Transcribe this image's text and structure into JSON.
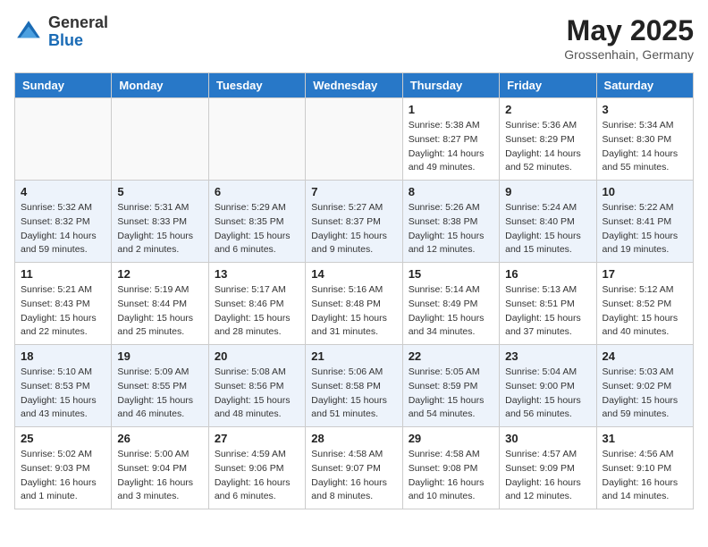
{
  "header": {
    "logo_general": "General",
    "logo_blue": "Blue",
    "month_year": "May 2025",
    "location": "Grossenhain, Germany"
  },
  "weekdays": [
    "Sunday",
    "Monday",
    "Tuesday",
    "Wednesday",
    "Thursday",
    "Friday",
    "Saturday"
  ],
  "weeks": [
    [
      {
        "day": "",
        "info": ""
      },
      {
        "day": "",
        "info": ""
      },
      {
        "day": "",
        "info": ""
      },
      {
        "day": "",
        "info": ""
      },
      {
        "day": "1",
        "info": "Sunrise: 5:38 AM\nSunset: 8:27 PM\nDaylight: 14 hours\nand 49 minutes."
      },
      {
        "day": "2",
        "info": "Sunrise: 5:36 AM\nSunset: 8:29 PM\nDaylight: 14 hours\nand 52 minutes."
      },
      {
        "day": "3",
        "info": "Sunrise: 5:34 AM\nSunset: 8:30 PM\nDaylight: 14 hours\nand 55 minutes."
      }
    ],
    [
      {
        "day": "4",
        "info": "Sunrise: 5:32 AM\nSunset: 8:32 PM\nDaylight: 14 hours\nand 59 minutes."
      },
      {
        "day": "5",
        "info": "Sunrise: 5:31 AM\nSunset: 8:33 PM\nDaylight: 15 hours\nand 2 minutes."
      },
      {
        "day": "6",
        "info": "Sunrise: 5:29 AM\nSunset: 8:35 PM\nDaylight: 15 hours\nand 6 minutes."
      },
      {
        "day": "7",
        "info": "Sunrise: 5:27 AM\nSunset: 8:37 PM\nDaylight: 15 hours\nand 9 minutes."
      },
      {
        "day": "8",
        "info": "Sunrise: 5:26 AM\nSunset: 8:38 PM\nDaylight: 15 hours\nand 12 minutes."
      },
      {
        "day": "9",
        "info": "Sunrise: 5:24 AM\nSunset: 8:40 PM\nDaylight: 15 hours\nand 15 minutes."
      },
      {
        "day": "10",
        "info": "Sunrise: 5:22 AM\nSunset: 8:41 PM\nDaylight: 15 hours\nand 19 minutes."
      }
    ],
    [
      {
        "day": "11",
        "info": "Sunrise: 5:21 AM\nSunset: 8:43 PM\nDaylight: 15 hours\nand 22 minutes."
      },
      {
        "day": "12",
        "info": "Sunrise: 5:19 AM\nSunset: 8:44 PM\nDaylight: 15 hours\nand 25 minutes."
      },
      {
        "day": "13",
        "info": "Sunrise: 5:17 AM\nSunset: 8:46 PM\nDaylight: 15 hours\nand 28 minutes."
      },
      {
        "day": "14",
        "info": "Sunrise: 5:16 AM\nSunset: 8:48 PM\nDaylight: 15 hours\nand 31 minutes."
      },
      {
        "day": "15",
        "info": "Sunrise: 5:14 AM\nSunset: 8:49 PM\nDaylight: 15 hours\nand 34 minutes."
      },
      {
        "day": "16",
        "info": "Sunrise: 5:13 AM\nSunset: 8:51 PM\nDaylight: 15 hours\nand 37 minutes."
      },
      {
        "day": "17",
        "info": "Sunrise: 5:12 AM\nSunset: 8:52 PM\nDaylight: 15 hours\nand 40 minutes."
      }
    ],
    [
      {
        "day": "18",
        "info": "Sunrise: 5:10 AM\nSunset: 8:53 PM\nDaylight: 15 hours\nand 43 minutes."
      },
      {
        "day": "19",
        "info": "Sunrise: 5:09 AM\nSunset: 8:55 PM\nDaylight: 15 hours\nand 46 minutes."
      },
      {
        "day": "20",
        "info": "Sunrise: 5:08 AM\nSunset: 8:56 PM\nDaylight: 15 hours\nand 48 minutes."
      },
      {
        "day": "21",
        "info": "Sunrise: 5:06 AM\nSunset: 8:58 PM\nDaylight: 15 hours\nand 51 minutes."
      },
      {
        "day": "22",
        "info": "Sunrise: 5:05 AM\nSunset: 8:59 PM\nDaylight: 15 hours\nand 54 minutes."
      },
      {
        "day": "23",
        "info": "Sunrise: 5:04 AM\nSunset: 9:00 PM\nDaylight: 15 hours\nand 56 minutes."
      },
      {
        "day": "24",
        "info": "Sunrise: 5:03 AM\nSunset: 9:02 PM\nDaylight: 15 hours\nand 59 minutes."
      }
    ],
    [
      {
        "day": "25",
        "info": "Sunrise: 5:02 AM\nSunset: 9:03 PM\nDaylight: 16 hours\nand 1 minute."
      },
      {
        "day": "26",
        "info": "Sunrise: 5:00 AM\nSunset: 9:04 PM\nDaylight: 16 hours\nand 3 minutes."
      },
      {
        "day": "27",
        "info": "Sunrise: 4:59 AM\nSunset: 9:06 PM\nDaylight: 16 hours\nand 6 minutes."
      },
      {
        "day": "28",
        "info": "Sunrise: 4:58 AM\nSunset: 9:07 PM\nDaylight: 16 hours\nand 8 minutes."
      },
      {
        "day": "29",
        "info": "Sunrise: 4:58 AM\nSunset: 9:08 PM\nDaylight: 16 hours\nand 10 minutes."
      },
      {
        "day": "30",
        "info": "Sunrise: 4:57 AM\nSunset: 9:09 PM\nDaylight: 16 hours\nand 12 minutes."
      },
      {
        "day": "31",
        "info": "Sunrise: 4:56 AM\nSunset: 9:10 PM\nDaylight: 16 hours\nand 14 minutes."
      }
    ]
  ]
}
